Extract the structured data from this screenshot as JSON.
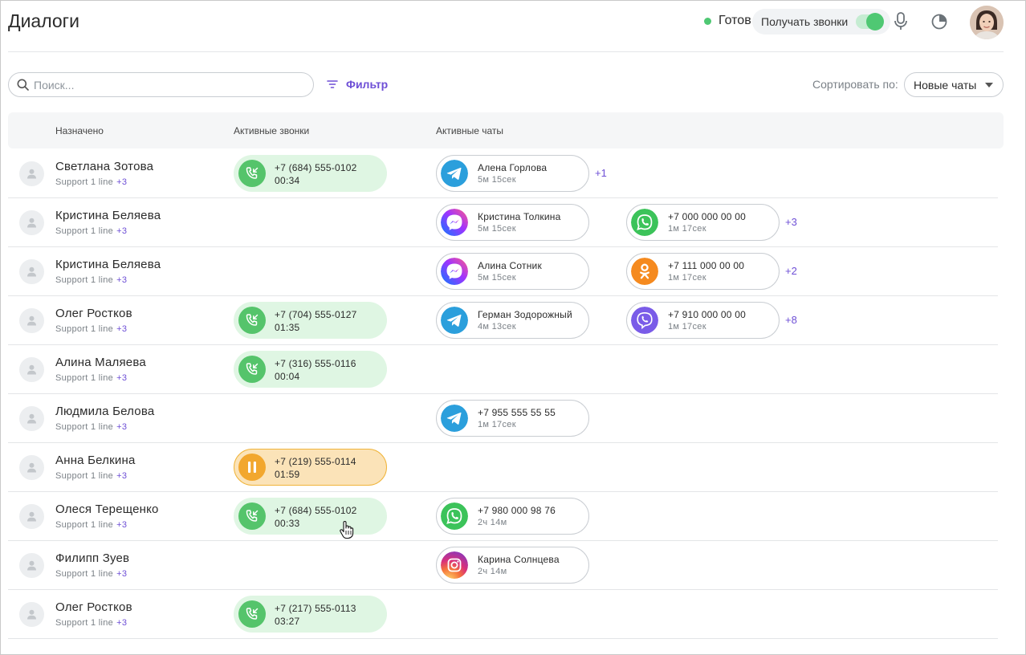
{
  "header": {
    "title": "Диалоги",
    "status": "Готов",
    "status_color": "#4fc873",
    "calls_toggle_label": "Получать звонки",
    "calls_toggle_on": true,
    "mic_icon": "microphone-icon",
    "stats_icon": "pie-chart-icon"
  },
  "toolbar": {
    "search_placeholder": "Поиск...",
    "filter_label": "Фильтр",
    "sort_label": "Сортировать по:",
    "sort_value": "Новые чаты"
  },
  "columns": {
    "assigned": "Назначено",
    "calls": "Активные звонки",
    "chats": "Активные чаты"
  },
  "colors": {
    "accent": "#6e4fd6",
    "call_active": "#55c46b",
    "call_hold": "#f2a72e"
  },
  "rows": [
    {
      "name": "Светлана Зотова",
      "group": "Support 1 line",
      "group_more": "+3",
      "call": {
        "number": "+7 (684) 555-0102",
        "time": "00:34",
        "state": "active"
      },
      "chats": [
        {
          "channel": "telegram",
          "name": "Алена Горлова",
          "time": "5м 15сек"
        }
      ],
      "chats_more": "+1"
    },
    {
      "name": "Кристина Беляева",
      "group": "Support 1 line",
      "group_more": "+3",
      "call": null,
      "chats": [
        {
          "channel": "messenger",
          "name": "Кристина Толкина",
          "time": "5м 15сек"
        },
        {
          "channel": "whatsapp",
          "name": "+7 000 000 00 00",
          "time": "1м 17сек"
        }
      ],
      "chats_more": "+3"
    },
    {
      "name": "Кристина Беляева",
      "group": "Support 1 line",
      "group_more": "+3",
      "call": null,
      "chats": [
        {
          "channel": "messenger",
          "name": "Алина Сотник",
          "time": "5м 15сек"
        },
        {
          "channel": "odnoklassniki",
          "name": "+7 111 000 00 00",
          "time": "1м 17сек"
        }
      ],
      "chats_more": "+2"
    },
    {
      "name": "Олег Ростков",
      "group": "Support 1 line",
      "group_more": "+3",
      "call": {
        "number": "+7 (704) 555-0127",
        "time": "01:35",
        "state": "active"
      },
      "chats": [
        {
          "channel": "telegram",
          "name": "Герман Зодорожный",
          "time": "4м 13сек"
        },
        {
          "channel": "viber",
          "name": "+7 910 000 00 00",
          "time": "1м 17сек"
        }
      ],
      "chats_more": "+8"
    },
    {
      "name": "Алина Маляева",
      "group": "Support 1 line",
      "group_more": "+3",
      "call": {
        "number": "+7 (316) 555-0116",
        "time": "00:04",
        "state": "active"
      },
      "chats": [],
      "chats_more": ""
    },
    {
      "name": "Людмила Белова",
      "group": "Support 1 line",
      "group_more": "+3",
      "call": null,
      "chats": [
        {
          "channel": "telegram",
          "name": "+7 955 555 55 55",
          "time": "1м 17сек"
        }
      ],
      "chats_more": ""
    },
    {
      "name": "Анна Белкина",
      "group": "Support 1 line",
      "group_more": "+3",
      "call": {
        "number": "+7 (219) 555-0114",
        "time": "01:59",
        "state": "hold"
      },
      "chats": [],
      "chats_more": ""
    },
    {
      "name": "Олеся Терещенко",
      "group": "Support 1 line",
      "group_more": "+3",
      "call": {
        "number": "+7 (684) 555-0102",
        "time": "00:33",
        "state": "active"
      },
      "chats": [
        {
          "channel": "whatsapp",
          "name": "+7 980 000 98 76",
          "time": " 2ч 14м"
        }
      ],
      "chats_more": ""
    },
    {
      "name": "Филипп Зуев",
      "group": "Support 1 line",
      "group_more": "+3",
      "call": null,
      "chats": [
        {
          "channel": "instagram",
          "name": "Карина Солнцева",
          "time": "2ч 14м"
        }
      ],
      "chats_more": ""
    },
    {
      "name": "Олег Ростков",
      "group": "Support 1 line",
      "group_more": "+3",
      "call": {
        "number": "+7 (217) 555-0113",
        "time": "03:27",
        "state": "active"
      },
      "chats": [],
      "chats_more": ""
    }
  ]
}
